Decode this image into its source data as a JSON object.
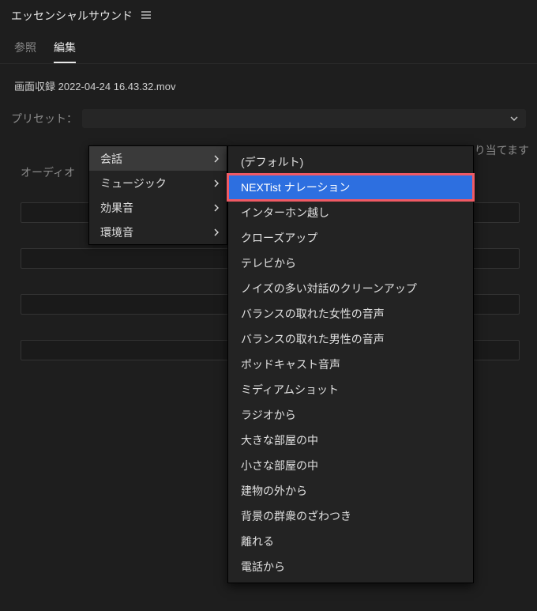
{
  "panel": {
    "title": "エッセンシャルサウンド"
  },
  "tabs": {
    "reference": "参照",
    "edit": "編集"
  },
  "file": {
    "name": "画面収録 2022-04-24 16.43.32.mov"
  },
  "preset": {
    "label": "プリセット："
  },
  "content": {
    "audio_label": "オーディオ",
    "assign_tail": "り当てます"
  },
  "menu": {
    "items": [
      {
        "label": "会話",
        "hovered": true
      },
      {
        "label": "ミュージック",
        "hovered": false
      },
      {
        "label": "効果音",
        "hovered": false
      },
      {
        "label": "環境音",
        "hovered": false
      }
    ]
  },
  "submenu": {
    "items": [
      "(デフォルト)",
      "NEXTist ナレーション",
      "インターホン越し",
      "クローズアップ",
      "テレビから",
      "ノイズの多い対話のクリーンアップ",
      "バランスの取れた女性の音声",
      "バランスの取れた男性の音声",
      "ポッドキャスト音声",
      "ミディアムショット",
      "ラジオから",
      "大きな部屋の中",
      "小さな部屋の中",
      "建物の外から",
      "背景の群衆のざわつき",
      "離れる",
      "電話から"
    ],
    "selected_index": 1
  }
}
